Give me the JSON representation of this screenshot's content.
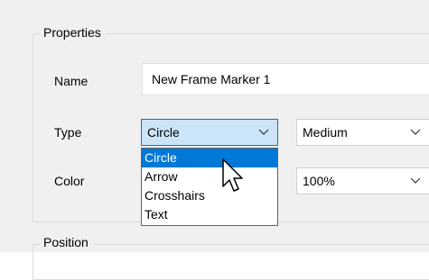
{
  "properties": {
    "group_title": "Properties",
    "name_label": "Name",
    "name_value": "New Frame Marker 1",
    "type_label": "Type",
    "type_value": "Circle",
    "size_value": "Medium",
    "color_label": "Color",
    "opacity_value": "100%"
  },
  "type_dropdown": {
    "options": [
      "Circle",
      "Arrow",
      "Crosshairs",
      "Text"
    ],
    "selected": "Circle"
  },
  "position": {
    "group_title": "Position"
  },
  "icons": {
    "chevron": "chevron-down-icon",
    "cursor": "mouse-pointer-icon"
  },
  "colors": {
    "accent": "#0078d7",
    "focus_fill": "#cce4f7",
    "panel_bg": "#f0f0f0"
  }
}
